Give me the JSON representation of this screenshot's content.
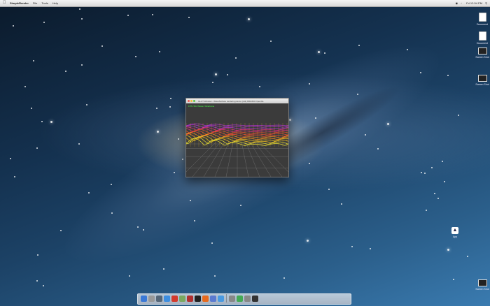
{
  "menubar": {
    "app_name": "SimpleRender",
    "menus": [
      "File",
      "Tools",
      "Help"
    ],
    "clock": "Fri 12:54 PM"
  },
  "desktop_icons": [
    {
      "label": "Document",
      "type": "doc"
    },
    {
      "label": "Document",
      "type": "doc"
    },
    {
      "label": "Screen Shot",
      "type": "screen"
    },
    {
      "label": "Screen Shot",
      "type": "screen"
    },
    {
      "label": "App",
      "type": "app"
    },
    {
      "label": "Screen Shot",
      "type": "screen"
    }
  ],
  "window": {
    "title": "GLUT Window - WaveSurface rendering demo (x11) 800x600 OpenGL",
    "status": "FPS: 59.8 Mode: Wireframe"
  },
  "dock": {
    "apps": [
      "Finder",
      "Launchpad",
      "Mission Control",
      "Safari",
      "Calendar",
      "Preview",
      "Photo Booth",
      "Terminal",
      "Firefox",
      "Xcode",
      "App Store",
      "Utilities",
      "Grapher",
      "System Preferences",
      "X11"
    ],
    "colors": [
      "#3b79d6",
      "#999999",
      "#556677",
      "#3d8ee0",
      "#d33a2c",
      "#7aa860",
      "#b03030",
      "#222222",
      "#e66a1e",
      "#5a7ad0",
      "#4a9ae0",
      "#888888",
      "#44aa55",
      "#888888",
      "#333333"
    ]
  }
}
